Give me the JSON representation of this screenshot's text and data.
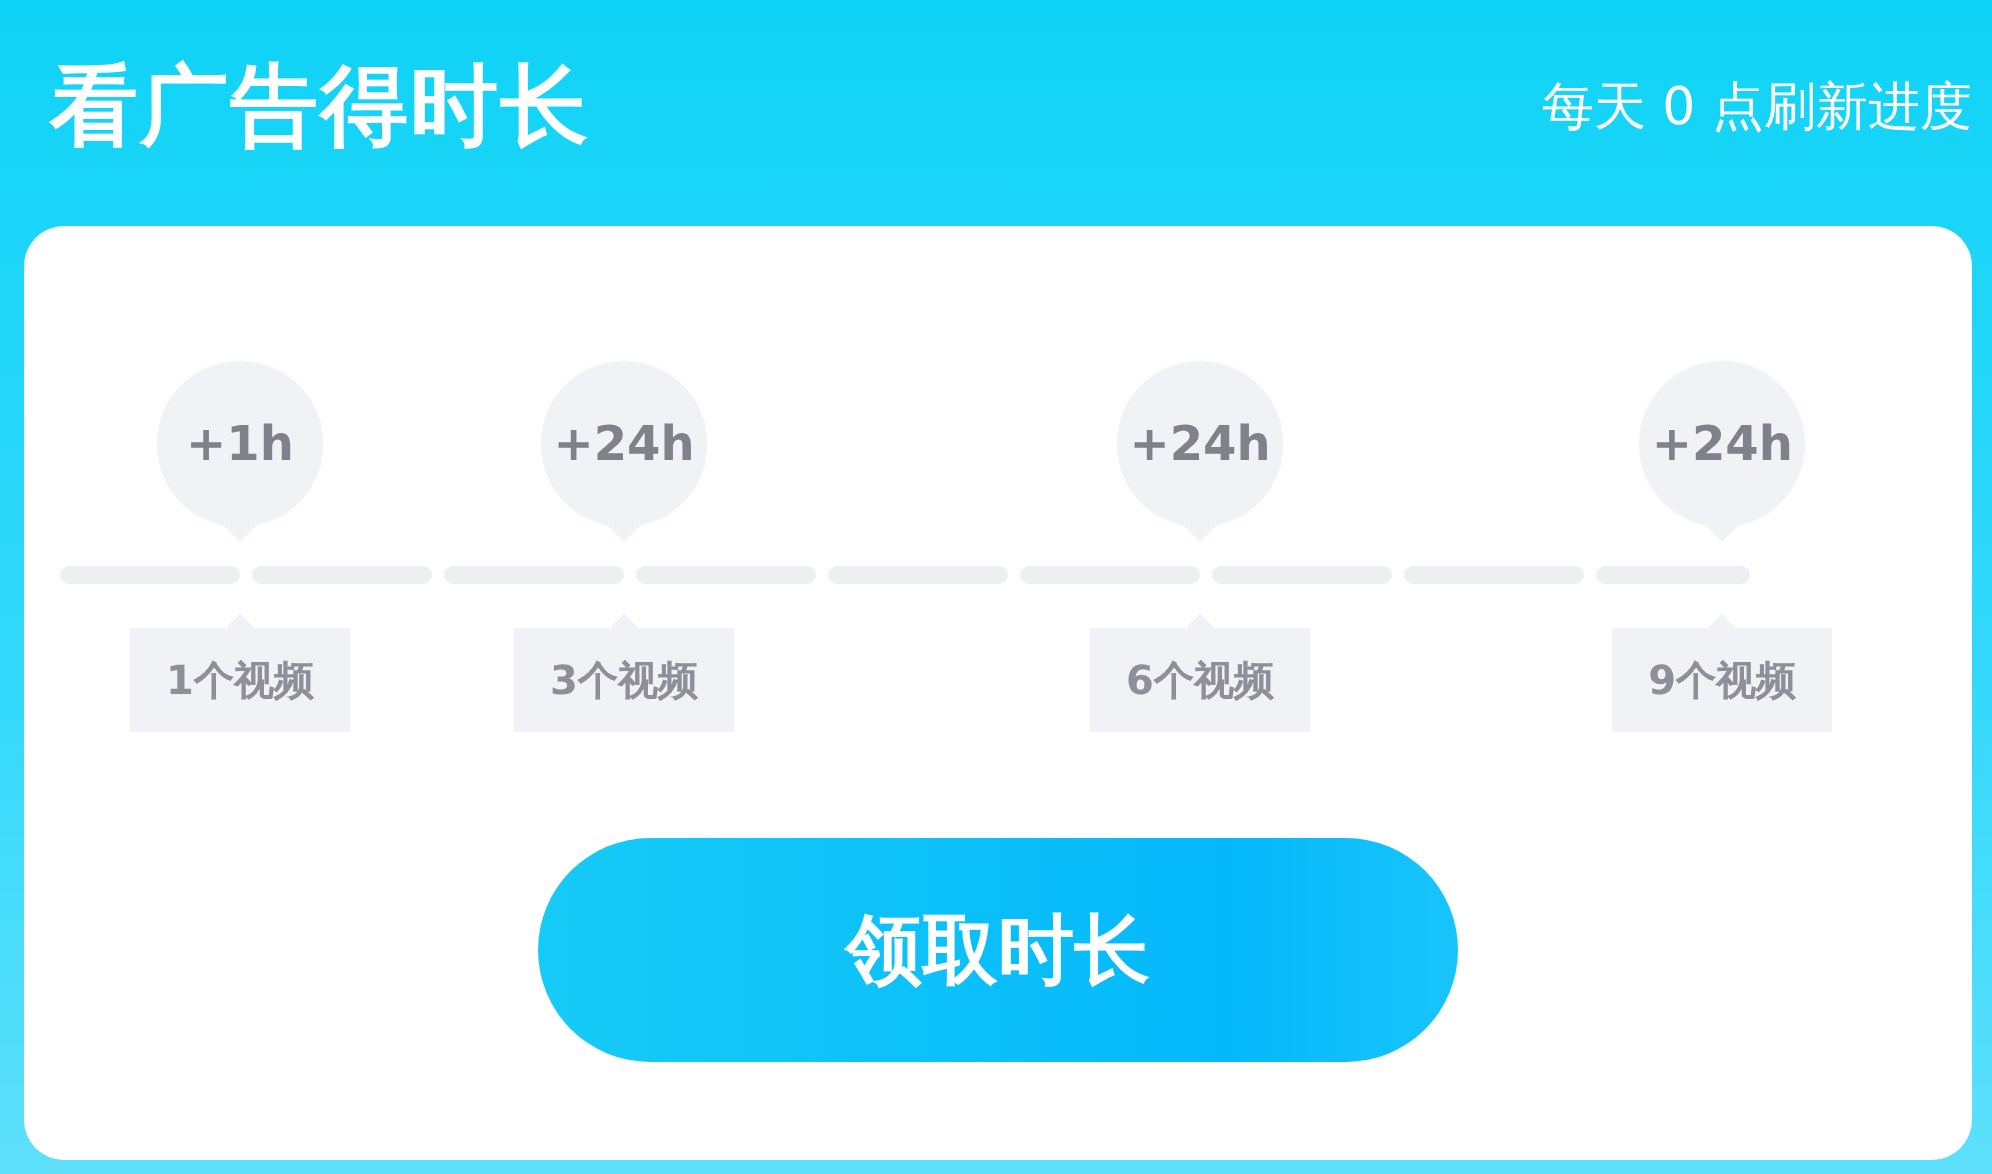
{
  "header": {
    "title": "看广告得时长",
    "note": "每天 0 点刷新进度"
  },
  "segments": [
    {
      "filled": false,
      "reward": "+1h",
      "requirement": "1个视频"
    },
    {
      "filled": false
    },
    {
      "filled": false,
      "reward": "+24h",
      "requirement": "3个视频"
    },
    {
      "filled": false
    },
    {
      "filled": false
    },
    {
      "filled": false,
      "reward": "+24h",
      "requirement": "6个视频"
    },
    {
      "filled": false
    },
    {
      "filled": false
    },
    {
      "filled": false,
      "reward": "+24h",
      "requirement": "9个视频"
    }
  ],
  "claim_button": "领取时长"
}
